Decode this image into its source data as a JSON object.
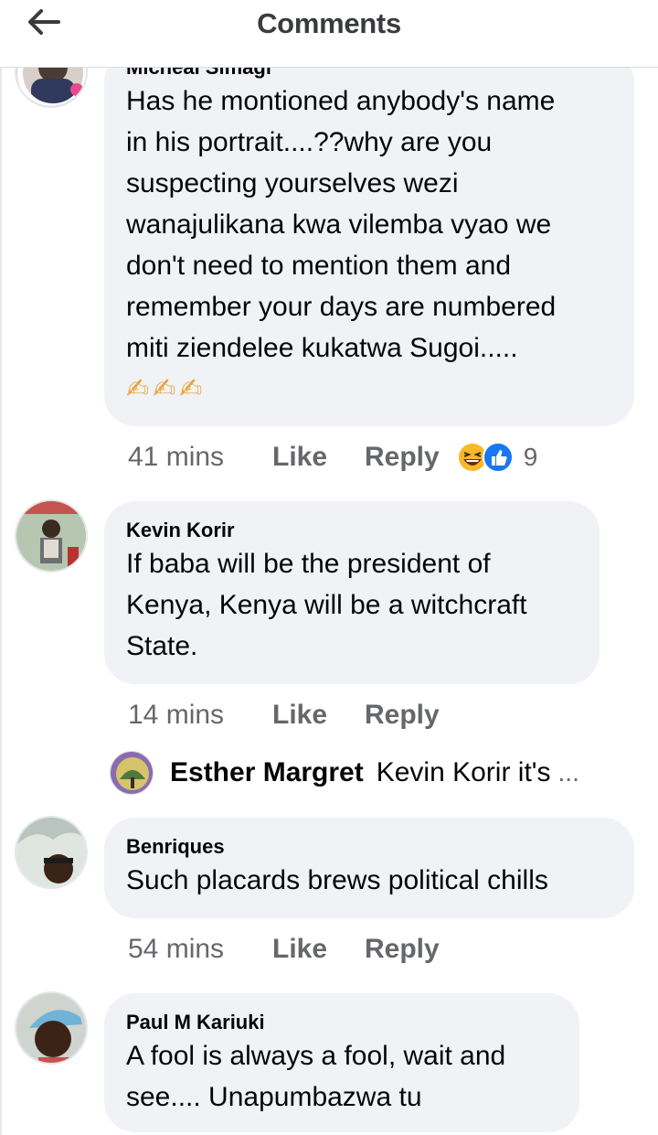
{
  "header": {
    "title": "Comments",
    "back_icon": "arrow-left-icon"
  },
  "comments": [
    {
      "author": "Micheal Simagi",
      "lines": [
        "Has he montioned anybody's name",
        "in his portrait....??why are you",
        "suspecting yourselves wezi",
        "wanajulikana kwa vilemba vyao we",
        "don't need to mention them and",
        "remember your days are numbered",
        "miti ziendelee kukatwa Sugoi....."
      ],
      "emojis": "✍✍✍",
      "time": "41 mins",
      "like": "Like",
      "reply": "Reply",
      "reaction_count": "9",
      "reaction_icons": [
        "laughing-emoji-icon",
        "thumbs-up-icon"
      ]
    },
    {
      "author": "Kevin Korir",
      "lines": [
        "If baba will be the president of",
        "Kenya, Kenya will be a witchcraft",
        "State."
      ],
      "time": "14 mins",
      "like": "Like",
      "reply": "Reply",
      "reply_preview": {
        "author": "Esther Margret",
        "text": "Kevin Korir it's",
        "ellipsis": "..."
      }
    },
    {
      "author": "Benriques",
      "lines": [
        "Such placards brews political chills"
      ],
      "time": "54 mins",
      "like": "Like",
      "reply": "Reply"
    },
    {
      "author": "Paul M Kariuki",
      "lines": [
        "A fool is always a fool, wait and",
        "see.... Unapumbazwa tu"
      ]
    }
  ],
  "colors": {
    "bubble": "#f0f2f5",
    "meta_text": "#65676b",
    "like_blue": "#1877f2",
    "haha_yellow": "#f7b928"
  }
}
